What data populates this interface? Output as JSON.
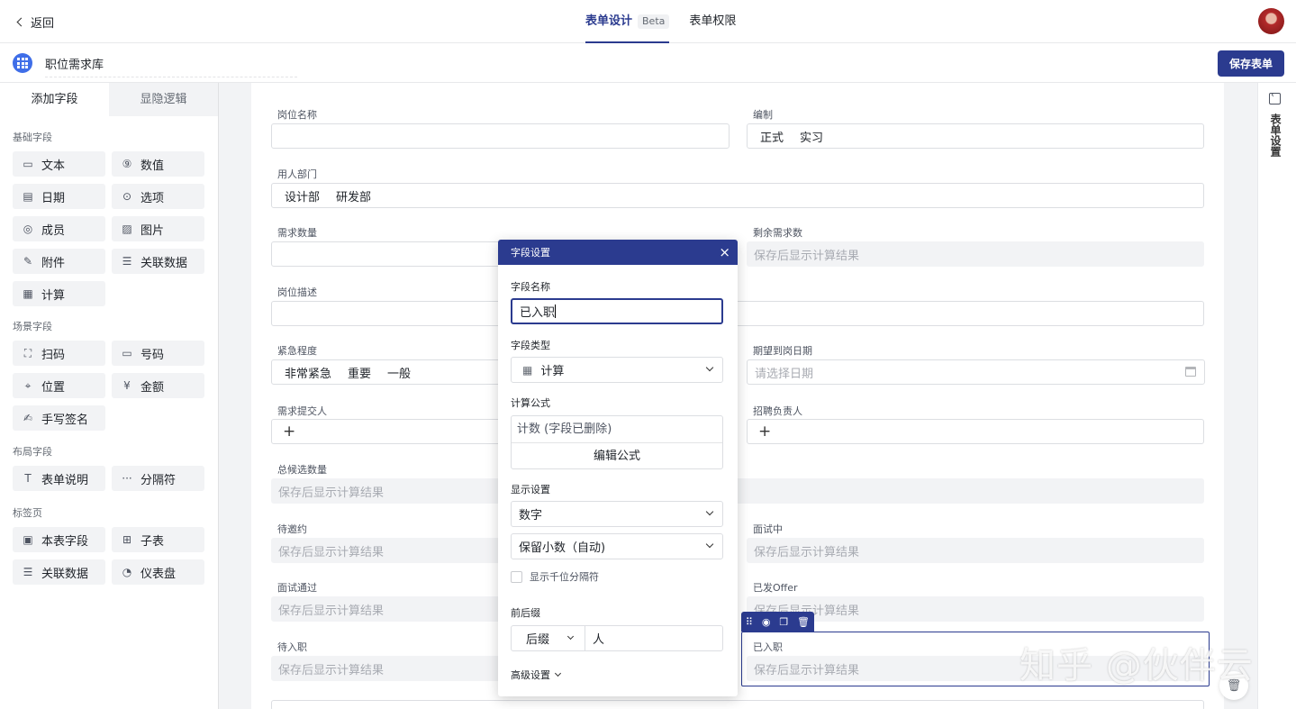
{
  "header": {
    "back_label": "返回",
    "tabs": [
      {
        "label": "表单设计",
        "badge": "Beta"
      },
      {
        "label": "表单权限"
      }
    ]
  },
  "app": {
    "name": "职位需求库",
    "save_label": "保存表单"
  },
  "left_panel": {
    "tabs": [
      "添加字段",
      "显隐逻辑"
    ],
    "groups": [
      {
        "title": "基础字段",
        "items": [
          {
            "label": "文本",
            "icon": "text-field-icon"
          },
          {
            "label": "数值",
            "icon": "number-icon"
          },
          {
            "label": "日期",
            "icon": "calendar-icon"
          },
          {
            "label": "选项",
            "icon": "option-icon"
          },
          {
            "label": "成员",
            "icon": "member-icon"
          },
          {
            "label": "图片",
            "icon": "image-icon"
          },
          {
            "label": "附件",
            "icon": "paperclip-icon"
          },
          {
            "label": "关联数据",
            "icon": "linked-data-icon"
          },
          {
            "label": "计算",
            "icon": "calculator-icon"
          }
        ]
      },
      {
        "title": "场景字段",
        "items": [
          {
            "label": "扫码",
            "icon": "scan-icon"
          },
          {
            "label": "号码",
            "icon": "serial-number-icon"
          },
          {
            "label": "位置",
            "icon": "location-pin-icon"
          },
          {
            "label": "金额",
            "icon": "currency-icon"
          },
          {
            "label": "手写签名",
            "icon": "signature-icon"
          }
        ]
      },
      {
        "title": "布局字段",
        "items": [
          {
            "label": "表单说明",
            "icon": "text-t-icon"
          },
          {
            "label": "分隔符",
            "icon": "ellipsis-icon"
          }
        ]
      },
      {
        "title": "标签页",
        "items": [
          {
            "label": "本表字段",
            "icon": "table-field-icon"
          },
          {
            "label": "子表",
            "icon": "subtable-icon"
          },
          {
            "label": "关联数据",
            "icon": "linked-data-icon"
          },
          {
            "label": "仪表盘",
            "icon": "dashboard-icon"
          }
        ]
      }
    ]
  },
  "form": {
    "calc_placeholder": "保存后显示计算结果",
    "date_placeholder": "请选择日期",
    "fields": {
      "position_name": {
        "label": "岗位名称"
      },
      "headcount_type": {
        "label": "编制",
        "options": [
          "正式",
          "实习"
        ]
      },
      "department": {
        "label": "用人部门",
        "options": [
          "设计部",
          "研发部"
        ]
      },
      "demand_count": {
        "label": "需求数量"
      },
      "remaining": {
        "label": "剩余需求数"
      },
      "description": {
        "label": "岗位描述"
      },
      "urgency": {
        "label": "紧急程度",
        "options": [
          "非常紧急",
          "重要",
          "一般"
        ]
      },
      "expected_date": {
        "label": "期望到岗日期"
      },
      "submitter": {
        "label": "需求提交人"
      },
      "recruiter": {
        "label": "招聘负责人"
      },
      "total_candidates": {
        "label": "总候选数量"
      },
      "to_invite": {
        "label": "待邀约"
      },
      "interviewing": {
        "label": "面试中"
      },
      "passed": {
        "label": "面试通过"
      },
      "offer_sent": {
        "label": "已发Offer"
      },
      "to_join": {
        "label": "待入职"
      },
      "joined": {
        "label": "已入职"
      }
    }
  },
  "popup": {
    "title": "字段设置",
    "name_label": "字段名称",
    "name_value": "已入职",
    "type_label": "字段类型",
    "type_value": "计算",
    "formula_label": "计算公式",
    "formula_value": "计数 (字段已删除)",
    "edit_formula": "编辑公式",
    "display_label": "显示设置",
    "display_value": "数字",
    "decimal_value": "保留小数（自动)",
    "thousands_label": "显示千位分隔符",
    "affix_label": "前后缀",
    "affix_type": "后缀",
    "affix_value": "人",
    "advanced_label": "高级设置"
  },
  "right_rail": {
    "label": "表单设置"
  },
  "watermark": "知乎 @伙伴云",
  "colors": {
    "accent": "#2b3b8f",
    "app_icon": "#3f6ee8"
  }
}
